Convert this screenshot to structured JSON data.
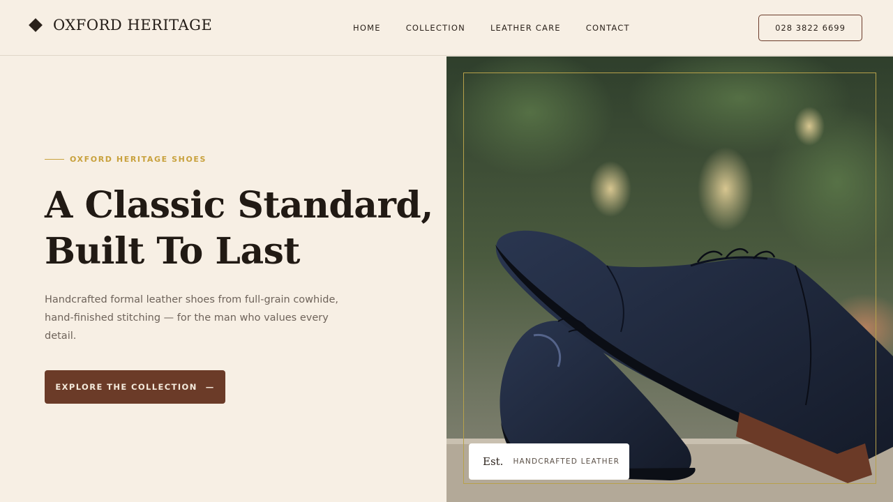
{
  "header": {
    "brand": "OXFORD HERITAGE",
    "nav": [
      {
        "label": "HOME"
      },
      {
        "label": "COLLECTION"
      },
      {
        "label": "LEATHER CARE"
      },
      {
        "label": "CONTACT"
      }
    ],
    "phone": "028 3822 6699"
  },
  "hero": {
    "eyebrow": "OXFORD HERITAGE SHOES",
    "headline_line1": "A Classic Standard,",
    "headline_line2": "Built To Last",
    "description": "Handcrafted formal leather shoes from full-grain cowhide, hand-finished stitching — for the man who values every detail.",
    "cta_label": "EXPLORE THE COLLECTION",
    "cta_arrow": "—"
  },
  "badge": {
    "prefix": "Est.",
    "text": "HANDCRAFTED LEATHER"
  },
  "colors": {
    "background": "#f7efe4",
    "accent_gold": "#c8a13c",
    "button_brown": "#6b3b28",
    "text_dark": "#211a14"
  },
  "icons": {
    "brand": "diamond-icon"
  }
}
